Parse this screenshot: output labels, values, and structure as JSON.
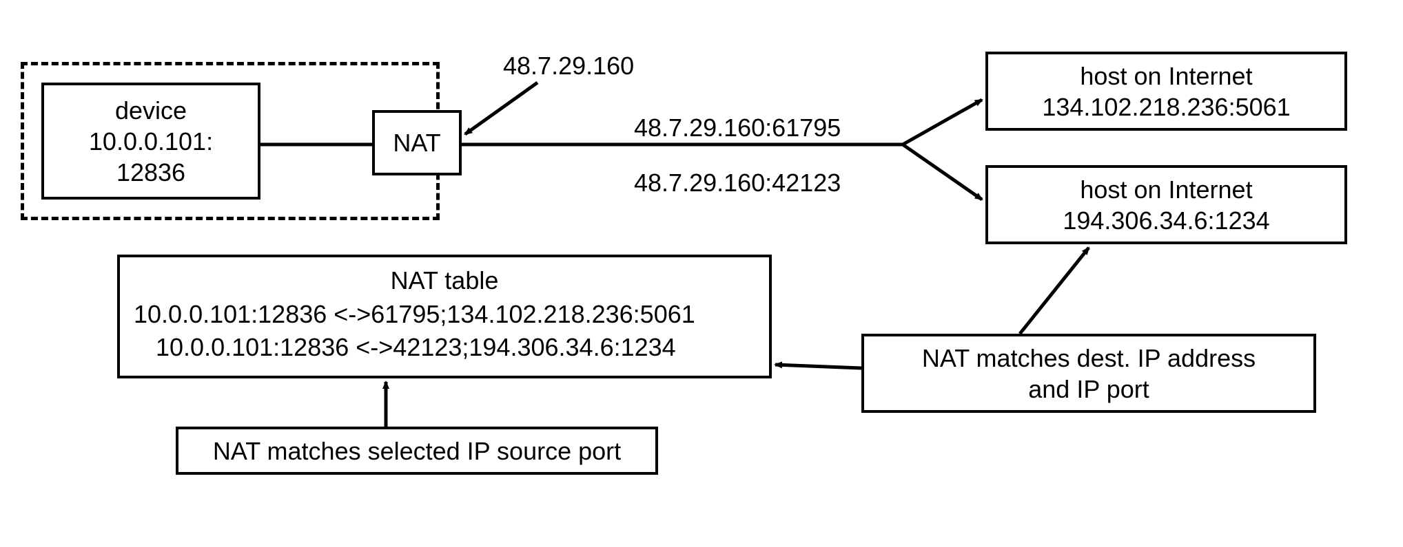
{
  "device": {
    "label1": "device",
    "label2": "10.0.0.101:",
    "label3": "12836"
  },
  "nat": {
    "label": "NAT",
    "ip": "48.7.29.160"
  },
  "flows": {
    "top": "48.7.29.160:61795",
    "bottom": "48.7.29.160:42123"
  },
  "hosts": {
    "h1_line1": "host on Internet",
    "h1_line2": "134.102.218.236:5061",
    "h2_line1": "host on Internet",
    "h2_line2": "194.306.34.6:1234"
  },
  "nat_table": {
    "title": "NAT table",
    "row1": "10.0.0.101:12836 <->61795;134.102.218.236:5061",
    "row2": "10.0.0.101:12836 <->42123;194.306.34.6:1234"
  },
  "annotations": {
    "src_port": "NAT matches selected IP source port",
    "dest": "NAT matches dest. IP address",
    "dest2": "and IP port"
  }
}
